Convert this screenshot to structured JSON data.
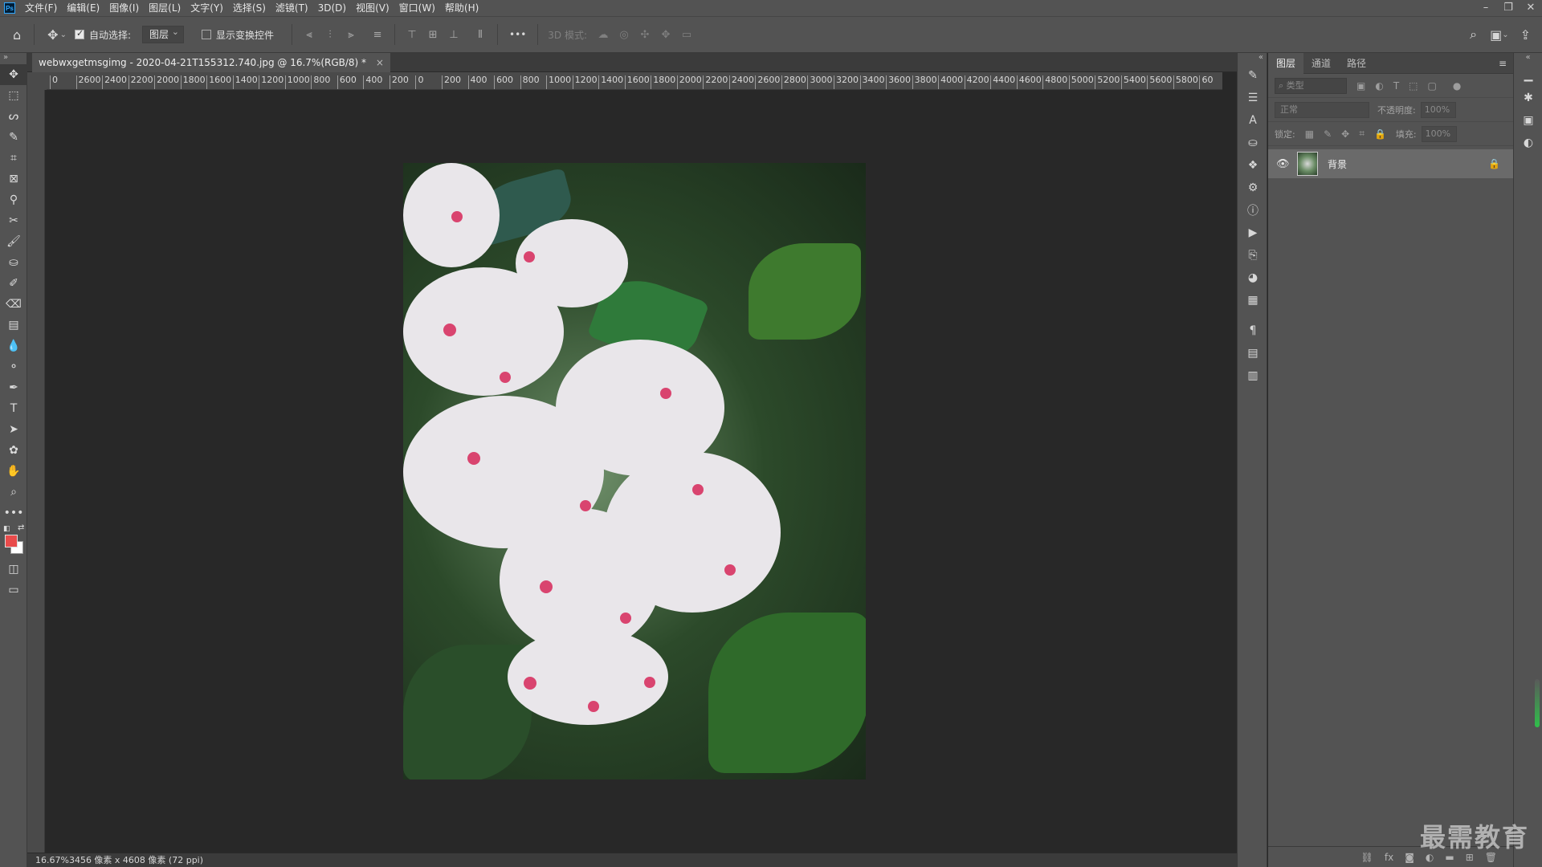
{
  "app": {
    "logo": "Ps"
  },
  "menus": [
    "文件(F)",
    "编辑(E)",
    "图像(I)",
    "图层(L)",
    "文字(Y)",
    "选择(S)",
    "滤镜(T)",
    "3D(D)",
    "视图(V)",
    "窗口(W)",
    "帮助(H)"
  ],
  "options": {
    "auto_select_label": "自动选择:",
    "auto_select_checked": true,
    "auto_select_value": "图层",
    "transform_controls_label": "显示变换控件",
    "more_label": "•••",
    "mode_3d_label": "3D 模式:"
  },
  "document": {
    "tab_title": "webwxgetmsgimg - 2020-04-21T155312.740.jpg @ 16.7%(RGB/8) *",
    "close": "×"
  },
  "ruler": {
    "ticks": [
      "0",
      "2600",
      "2400",
      "2200",
      "2000",
      "1800",
      "1600",
      "1400",
      "1200",
      "1000",
      "800",
      "600",
      "400",
      "200",
      "0",
      "200",
      "400",
      "600",
      "800",
      "1000",
      "1200",
      "1400",
      "1600",
      "1800",
      "2000",
      "2200",
      "2400",
      "2600",
      "2800",
      "3000",
      "3200",
      "3400",
      "3600",
      "3800",
      "4000",
      "4200",
      "4400",
      "4600",
      "4800",
      "5000",
      "5200",
      "5400",
      "5600",
      "5800",
      "60"
    ]
  },
  "status": {
    "text": "16.67%3456 像素 x 4608 像素 (72 ppi)"
  },
  "layers_panel": {
    "tabs": [
      "图层",
      "通道",
      "路径"
    ],
    "filter_placeholder": "类型",
    "blend_mode": "正常",
    "opacity_label": "不透明度:",
    "opacity_value": "100%",
    "lock_label": "锁定:",
    "fill_label": "填充:",
    "fill_value": "100%",
    "layer_name": "背景"
  },
  "watermark": "最需教育",
  "colors": {
    "foreground": "#e94b4b",
    "background": "#ffffff",
    "panel": "#535353"
  }
}
